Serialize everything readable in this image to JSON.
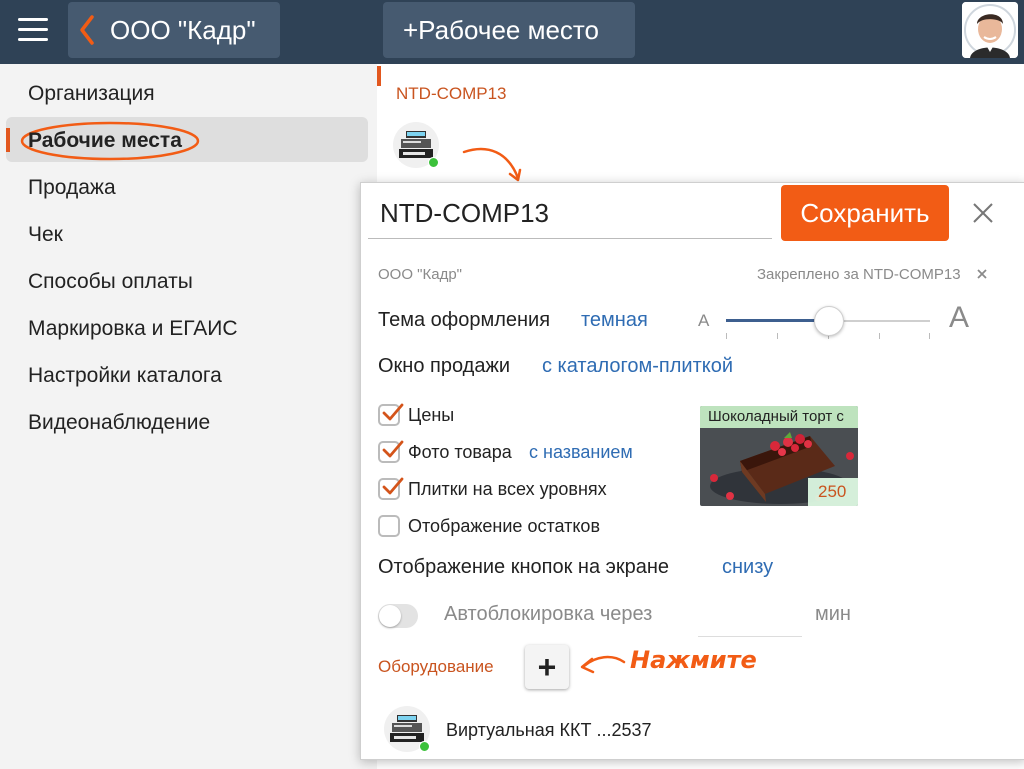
{
  "topbar": {
    "org_label": "ООО \"Кадр\"",
    "add_workplace_label": "+Рабочее место"
  },
  "sidebar": {
    "items": [
      {
        "label": "Организация"
      },
      {
        "label": "Рабочие места",
        "active": true
      },
      {
        "label": "Продажа"
      },
      {
        "label": "Чек"
      },
      {
        "label": "Способы оплаты"
      },
      {
        "label": "Маркировка и ЕГАИС"
      },
      {
        "label": "Настройки каталога"
      },
      {
        "label": "Видеонаблюдение"
      }
    ]
  },
  "main": {
    "workplace_title": "NTD-COMP13"
  },
  "dialog": {
    "name_value": "NTD-COMP13",
    "save_label": "Сохранить",
    "org_name": "ООО \"Кадр\"",
    "pinned_label": "Закреплено за NTD-COMP13",
    "theme": {
      "label": "Тема оформления",
      "value": "темная",
      "font_small": "A",
      "font_large": "A",
      "font_size_level": 0.5
    },
    "sale_window": {
      "label": "Окно продажи",
      "value": "с каталогом-плиткой"
    },
    "options": [
      {
        "label": "Цены",
        "checked": true
      },
      {
        "label": "Фото товара",
        "checked": true,
        "link": "с названием"
      },
      {
        "label": "Плитки на всех уровнях",
        "checked": true
      },
      {
        "label": "Отображение остатков",
        "checked": false
      }
    ],
    "tile_preview": {
      "name": "Шоколадный торт с",
      "price": "250"
    },
    "buttons_position": {
      "label": "Отображение кнопок на экране",
      "value": "снизу"
    },
    "autolock": {
      "label": "Автоблокировка через",
      "unit": "мин",
      "enabled": false
    },
    "equipment": {
      "label": "Оборудование",
      "add_symbol": "+",
      "hint": "Нажмите",
      "devices": [
        {
          "name": "Виртуальная ККТ ...2537"
        }
      ]
    }
  },
  "colors": {
    "topbar": "#2f4256",
    "accent_orange": "#f25c15",
    "link_blue": "#2f6cb3",
    "status_green": "#3cc13b"
  }
}
